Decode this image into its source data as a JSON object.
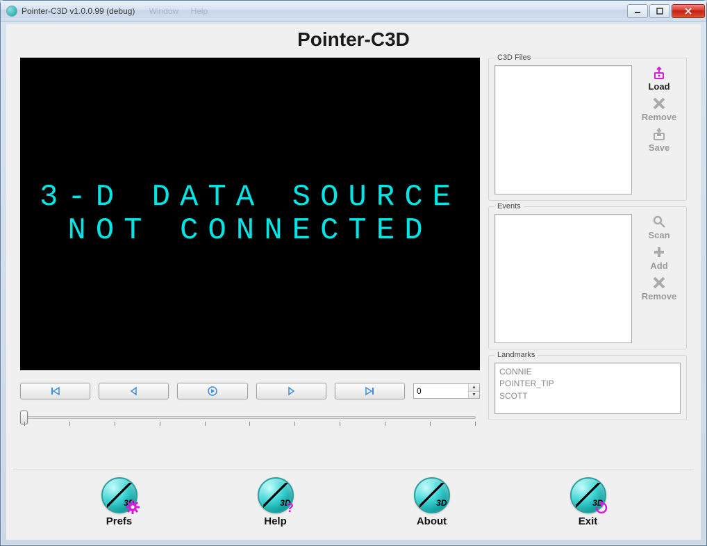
{
  "titlebar": {
    "title": "Pointer-C3D v1.0.0.99 (debug)"
  },
  "menus": {
    "window": "Window",
    "help": "Help"
  },
  "app_title": "Pointer-C3D",
  "viewport": {
    "line1": "3-D DATA SOURCE",
    "line2": "NOT CONNECTED"
  },
  "frame_value": "0",
  "groups": {
    "files": {
      "label": "C3D Files"
    },
    "events": {
      "label": "Events"
    },
    "landmarks": {
      "label": "Landmarks"
    }
  },
  "file_buttons": {
    "load": "Load",
    "remove": "Remove",
    "save": "Save"
  },
  "event_buttons": {
    "scan": "Scan",
    "add": "Add",
    "remove": "Remove"
  },
  "landmarks": [
    "CONNIE",
    "POINTER_TIP",
    "SCOTT"
  ],
  "bottom": {
    "prefs": "Prefs",
    "help": "Help",
    "about": "About",
    "exit": "Exit"
  },
  "badge3d": "3D"
}
